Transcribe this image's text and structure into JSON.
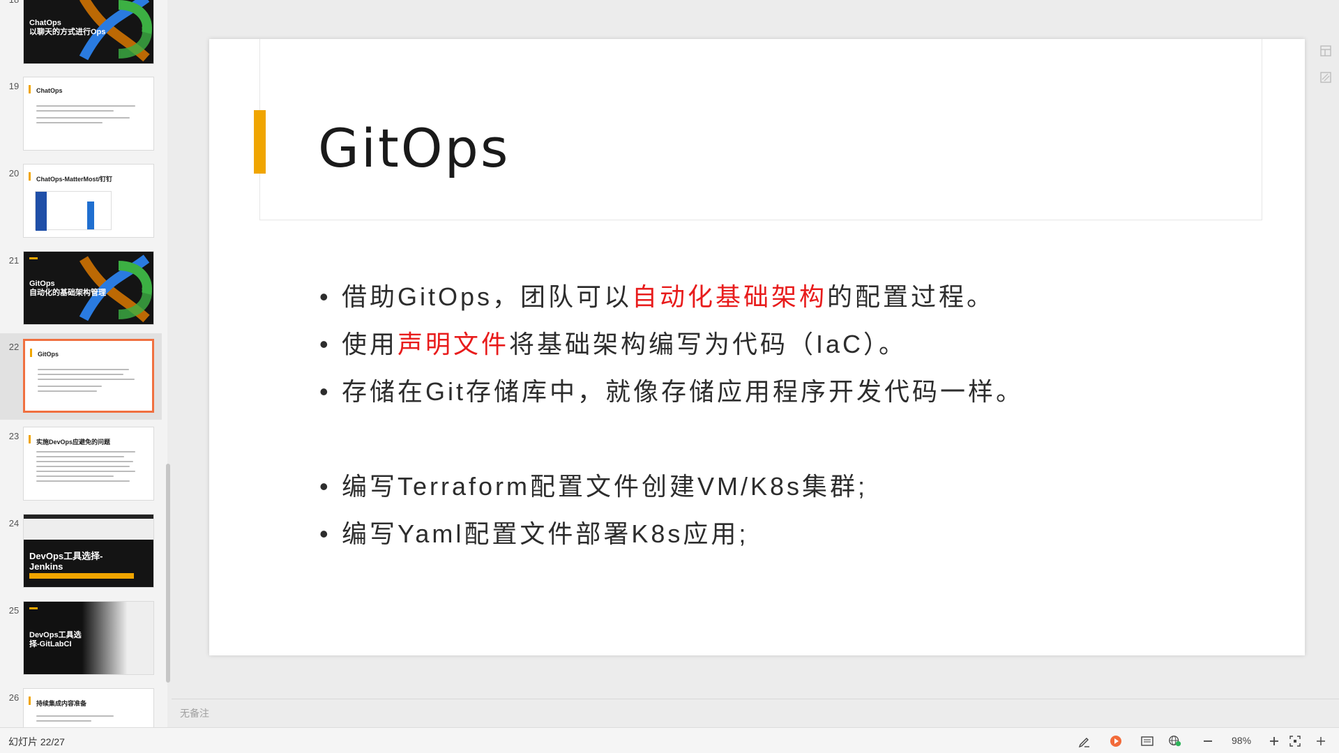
{
  "thumbnails": [
    {
      "num": "18",
      "title": "ChatOps\n以聊天的方式进行Ops",
      "dark": true
    },
    {
      "num": "19",
      "title": "ChatOps",
      "dark": false
    },
    {
      "num": "20",
      "title": "ChatOps-MatterMost/钉钉",
      "dark": false
    },
    {
      "num": "21",
      "title": "GitOps\n自动化的基础架构管理",
      "dark": true
    },
    {
      "num": "22",
      "title": "GitOps",
      "dark": false,
      "active": true
    },
    {
      "num": "23",
      "title": "实施DevOps应避免的问题",
      "dark": false
    },
    {
      "num": "24",
      "title": "DevOps工具选择-\nJenkins",
      "dark": true
    },
    {
      "num": "25",
      "title": "DevOps工具选\n择-GitLabCI",
      "dark": true
    },
    {
      "num": "26",
      "title": "持续集成内容准备",
      "dark": false
    }
  ],
  "slide": {
    "title": "GitOps",
    "bullets": [
      {
        "pre": "借助GitOps，团队可以",
        "hl": "自动化基础架构",
        "post": "的配置过程。"
      },
      {
        "pre": "使用",
        "hl": "声明文件",
        "post": "将基础架构编写为代码（IaC）。"
      },
      {
        "pre": "存储在Git存储库中，就像存储应用程序开发代码一样。",
        "hl": "",
        "post": ""
      },
      {
        "pre": "编写Terraform配置文件创建VM/K8s集群;",
        "hl": "",
        "post": ""
      },
      {
        "pre": "编写Yaml配置文件部署K8s应用;",
        "hl": "",
        "post": ""
      }
    ]
  },
  "notes": {
    "placeholder": "无备注"
  },
  "status": {
    "slide_count": "幻灯片 22/27",
    "zoom": "98%"
  },
  "colors": {
    "accent": "#f0a500",
    "highlight": "#e81c1c",
    "active_border": "#f07040"
  }
}
